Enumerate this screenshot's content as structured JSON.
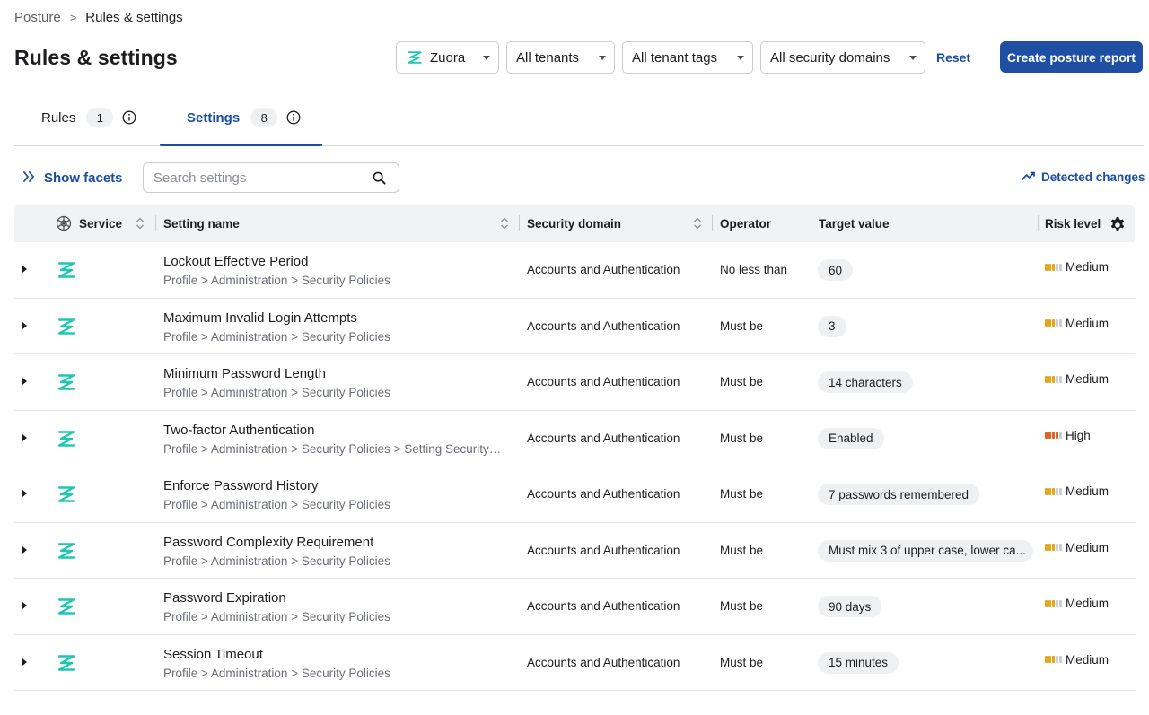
{
  "breadcrumb": {
    "parent": "Posture",
    "separator": ">",
    "current": "Rules & settings"
  },
  "page": {
    "title": "Rules & settings"
  },
  "filters": {
    "vendor": "Zuora",
    "tenants": "All tenants",
    "tenant_tags": "All tenant tags",
    "security_domains": "All security domains",
    "reset_label": "Reset"
  },
  "actions": {
    "create_report_label": "Create posture report"
  },
  "tabs": [
    {
      "label": "Rules",
      "count": "1",
      "selected": false
    },
    {
      "label": "Settings",
      "count": "8",
      "selected": true
    }
  ],
  "toolbar": {
    "show_facets_label": "Show facets",
    "search_placeholder": "Search settings",
    "detected_changes_label": "Detected changes"
  },
  "table": {
    "columns": {
      "service": "Service",
      "setting_name": "Setting name",
      "security_domain": "Security domain",
      "operator": "Operator",
      "target_value": "Target value",
      "risk_level": "Risk level"
    },
    "rows": [
      {
        "name": "Lockout Effective Period",
        "path": "Profile > Administration > Security Policies",
        "domain": "Accounts and Authentication",
        "operator": "No less than",
        "target": "60",
        "risk": "Medium"
      },
      {
        "name": "Maximum Invalid Login Attempts",
        "path": "Profile > Administration > Security Policies",
        "domain": "Accounts and Authentication",
        "operator": "Must be",
        "target": "3",
        "risk": "Medium"
      },
      {
        "name": "Minimum Password Length",
        "path": "Profile > Administration > Security Policies",
        "domain": "Accounts and Authentication",
        "operator": "Must be",
        "target": "14 characters",
        "risk": "Medium"
      },
      {
        "name": "Two-factor Authentication",
        "path": "Profile > Administration > Security Policies > Setting Security P...",
        "domain": "Accounts and Authentication",
        "operator": "Must be",
        "target": "Enabled",
        "risk": "High"
      },
      {
        "name": "Enforce Password History",
        "path": "Profile > Administration > Security Policies",
        "domain": "Accounts and Authentication",
        "operator": "Must be",
        "target": "7 passwords remembered",
        "risk": "Medium"
      },
      {
        "name": "Password Complexity Requirement",
        "path": "Profile > Administration > Security Policies",
        "domain": "Accounts and Authentication",
        "operator": "Must be",
        "target": "Must mix 3 of upper case, lower ca...",
        "risk": "Medium"
      },
      {
        "name": "Password Expiration",
        "path": "Profile > Administration > Security Policies",
        "domain": "Accounts and Authentication",
        "operator": "Must be",
        "target": "90 days",
        "risk": "Medium"
      },
      {
        "name": "Session Timeout",
        "path": "Profile > Administration > Security Policies",
        "domain": "Accounts and Authentication",
        "operator": "Must be",
        "target": "15 minutes",
        "risk": "Medium"
      }
    ]
  },
  "colors": {
    "primary": "#1f4fa3",
    "link": "#1b4ea1",
    "zuora_teal": "#1fc6b2",
    "risk_medium": "#e8a317",
    "risk_high": "#e0651e",
    "risk_empty": "#c9ccd1"
  },
  "icons": {
    "vendor": "zuora-logo-icon",
    "info": "info-icon",
    "facets": "double-chevron-right-icon",
    "search": "search-icon",
    "trend": "trend-line-icon",
    "sort": "sort-icon",
    "settings": "gear-icon"
  }
}
